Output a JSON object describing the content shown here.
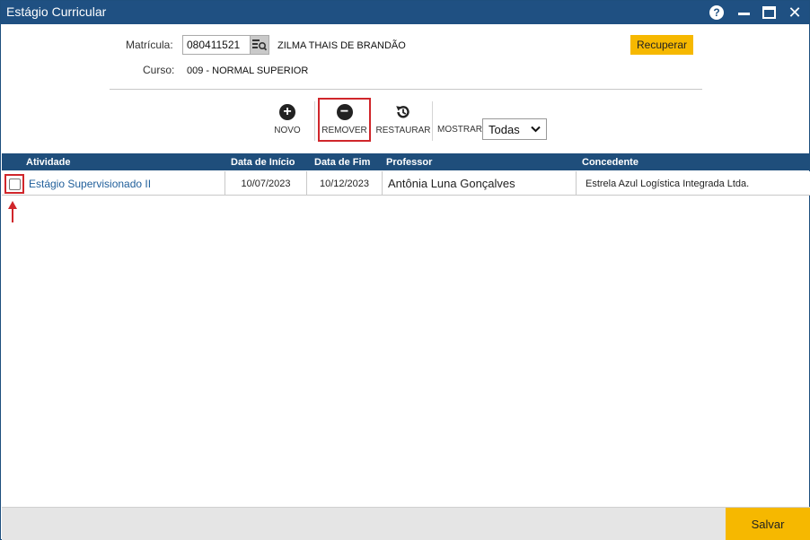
{
  "window": {
    "title": "Estágio Curricular"
  },
  "form": {
    "matricula_label": "Matrícula:",
    "matricula_value": "080411521",
    "student_name": "ZILMA THAIS DE BRANDÃO",
    "curso_label": "Curso:",
    "curso_value": "009 - NORMAL SUPERIOR",
    "recuperar_label": "Recuperar"
  },
  "toolbar": {
    "novo_label": "NOVO",
    "remover_label": "REMOVER",
    "restaurar_label": "RESTAURAR",
    "mostrar_label": "MOSTRAR:",
    "mostrar_value": "Todas"
  },
  "grid": {
    "columns": [
      "Atividade",
      "Data de Início",
      "Data de Fim",
      "Professor",
      "Concedente"
    ],
    "rows": [
      {
        "atividade": "Estágio Supervisionado II",
        "data_inicio": "10/07/2023",
        "data_fim": "10/12/2023",
        "professor": "Antônia Luna Gonçalves",
        "concedente": "Estrela Azul Logística Integrada Ltda."
      }
    ]
  },
  "footer": {
    "salvar_label": "Salvar"
  },
  "colors": {
    "titlebar": "#1f5082",
    "accent_yellow": "#f6b800",
    "highlight_red": "#d0262b",
    "grid_header": "#1f4e7b",
    "link_blue": "#1f5e9a"
  },
  "icons": [
    "help-icon",
    "minimize-icon",
    "maximize-icon",
    "close-icon",
    "search-list-icon",
    "plus-circle-icon",
    "minus-circle-icon",
    "restore-icon",
    "chevron-down-icon",
    "up-arrow-icon"
  ]
}
